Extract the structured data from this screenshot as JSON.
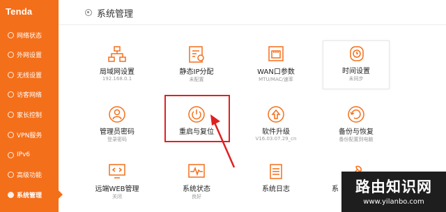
{
  "brand": {
    "logo": "Tenda",
    "accent": "#f46f1a"
  },
  "sidebar": {
    "items": [
      {
        "label": "网络状态",
        "icon": "network-status-icon"
      },
      {
        "label": "外网设置",
        "icon": "wan-globe-icon"
      },
      {
        "label": "无线设置",
        "icon": "wifi-icon"
      },
      {
        "label": "访客网络",
        "icon": "guest-icon"
      },
      {
        "label": "家长控制",
        "icon": "parent-control-icon"
      },
      {
        "label": "VPN服务",
        "icon": "vpn-icon"
      },
      {
        "label": "IPv6",
        "icon": "ipv6-icon"
      },
      {
        "label": "高级功能",
        "icon": "advanced-icon"
      },
      {
        "label": "系统管理",
        "icon": "gear-icon",
        "active": true
      }
    ]
  },
  "header": {
    "title": "系统管理",
    "icon": "gear-icon"
  },
  "tiles": [
    {
      "label": "局域网设置",
      "sub": "192.168.0.1",
      "icon": "lan-topology-icon"
    },
    {
      "label": "静态IP分配",
      "sub": "未配置",
      "icon": "static-ip-icon"
    },
    {
      "label": "WAN口参数",
      "sub": "MTU/MAC/速率",
      "icon": "ethernet-port-icon"
    },
    {
      "label": "时间设置",
      "sub": "未同步",
      "icon": "clock-icon"
    },
    {
      "label": "管理员密码",
      "sub": "登录密码",
      "icon": "admin-user-icon"
    },
    {
      "label": "重启与复位",
      "sub": "",
      "icon": "power-icon"
    },
    {
      "label": "软件升级",
      "sub": "V16.03.07.29_cn",
      "icon": "upgrade-arrow-icon"
    },
    {
      "label": "备份与恢复",
      "sub": "备份配置到电脑",
      "icon": "backup-restore-icon"
    },
    {
      "label": "远端WEB管理",
      "sub": "关闭",
      "icon": "remote-web-icon"
    },
    {
      "label": "系统状态",
      "sub": "良好",
      "icon": "system-status-icon"
    },
    {
      "label": "系统日志",
      "sub": "",
      "icon": "system-log-icon"
    },
    {
      "label": "系",
      "sub": "",
      "icon": "tools-icon"
    }
  ],
  "watermark": {
    "title": "路由知识网",
    "url": "www.yilanbo.com"
  },
  "colors": {
    "highlight": "#e02020",
    "icon_orange": "#f46f1a"
  }
}
